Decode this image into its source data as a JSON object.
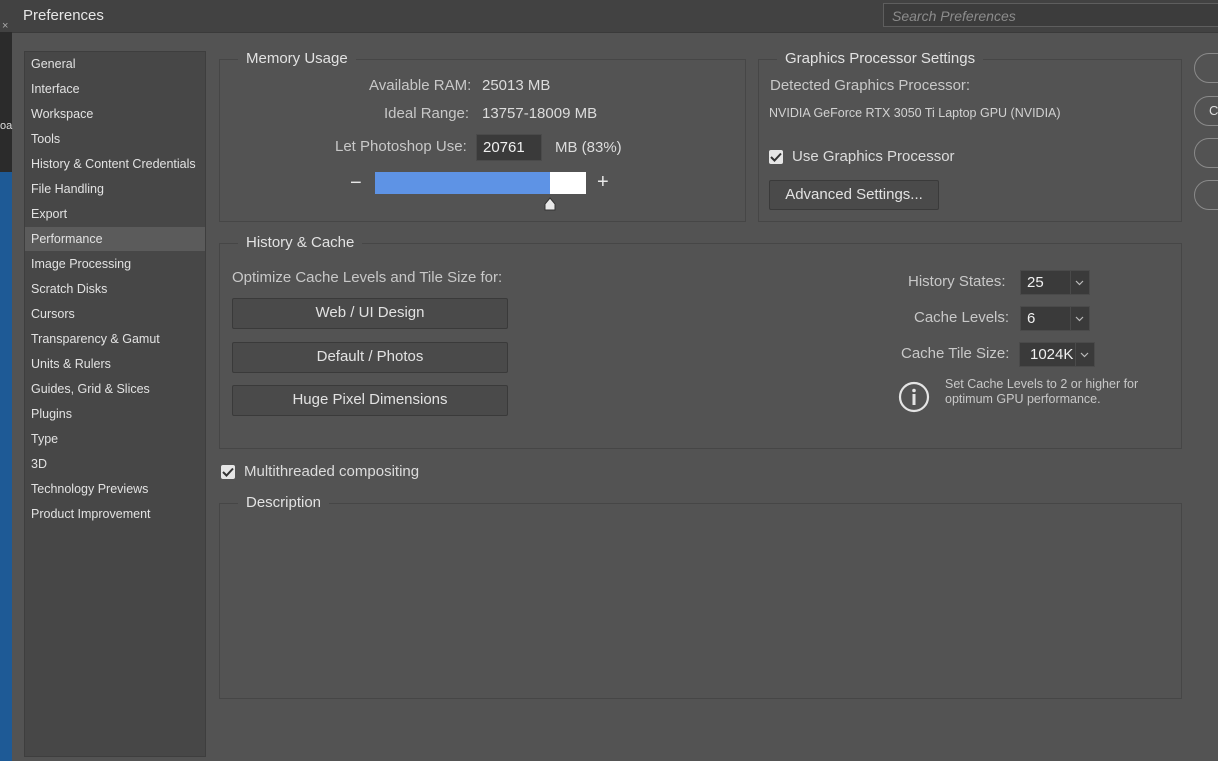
{
  "window": {
    "title": "Preferences"
  },
  "search": {
    "placeholder": "Search Preferences"
  },
  "background": {
    "edge_text": "oa",
    "close_glyph": "×"
  },
  "sidebar": {
    "items": [
      {
        "label": "General"
      },
      {
        "label": "Interface"
      },
      {
        "label": "Workspace"
      },
      {
        "label": "Tools"
      },
      {
        "label": "History & Content Credentials"
      },
      {
        "label": "File Handling"
      },
      {
        "label": "Export"
      },
      {
        "label": "Performance",
        "active": true
      },
      {
        "label": "Image Processing"
      },
      {
        "label": "Scratch Disks"
      },
      {
        "label": "Cursors"
      },
      {
        "label": "Transparency & Gamut"
      },
      {
        "label": "Units & Rulers"
      },
      {
        "label": "Guides, Grid & Slices"
      },
      {
        "label": "Plugins"
      },
      {
        "label": "Type"
      },
      {
        "label": "3D"
      },
      {
        "label": "Technology Previews"
      },
      {
        "label": "Product Improvement"
      }
    ]
  },
  "memory": {
    "title": "Memory Usage",
    "available_label": "Available RAM:",
    "available_value": "25013 MB",
    "ideal_label": "Ideal Range:",
    "ideal_value": "13757-18009 MB",
    "use_label": "Let Photoshop Use:",
    "use_value": "20761",
    "use_unit": "MB (83%)",
    "minus": "−",
    "plus": "+",
    "slider_fraction": 0.83
  },
  "gpu": {
    "title": "Graphics Processor Settings",
    "detected_label": "Detected Graphics Processor:",
    "gpu_name": "NVIDIA GeForce RTX 3050 Ti Laptop GPU (NVIDIA)",
    "use_gpu_label": "Use Graphics Processor",
    "use_gpu_checked": true,
    "advanced_button": "Advanced Settings..."
  },
  "history_cache": {
    "title": "History & Cache",
    "optimize_label": "Optimize Cache Levels and Tile Size for:",
    "buttons": [
      "Web / UI Design",
      "Default / Photos",
      "Huge Pixel Dimensions"
    ],
    "history_states_label": "History States:",
    "history_states_value": "25",
    "cache_levels_label": "Cache Levels:",
    "cache_levels_value": "6",
    "tile_size_label": "Cache Tile Size:",
    "tile_size_value": "1024K",
    "info_text_1": "Set Cache Levels to 2 or higher for",
    "info_text_2": "optimum GPU performance."
  },
  "multithreaded": {
    "label": "Multithreaded compositing",
    "checked": true
  },
  "description": {
    "title": "Description"
  },
  "right_buttons": [
    {
      "label": ""
    },
    {
      "label": "C"
    },
    {
      "label": ""
    },
    {
      "label": ""
    }
  ],
  "colors": {
    "slider_fill": "#5e93e5",
    "panel_bg": "#535353",
    "active_item": "#5b5b5b"
  }
}
